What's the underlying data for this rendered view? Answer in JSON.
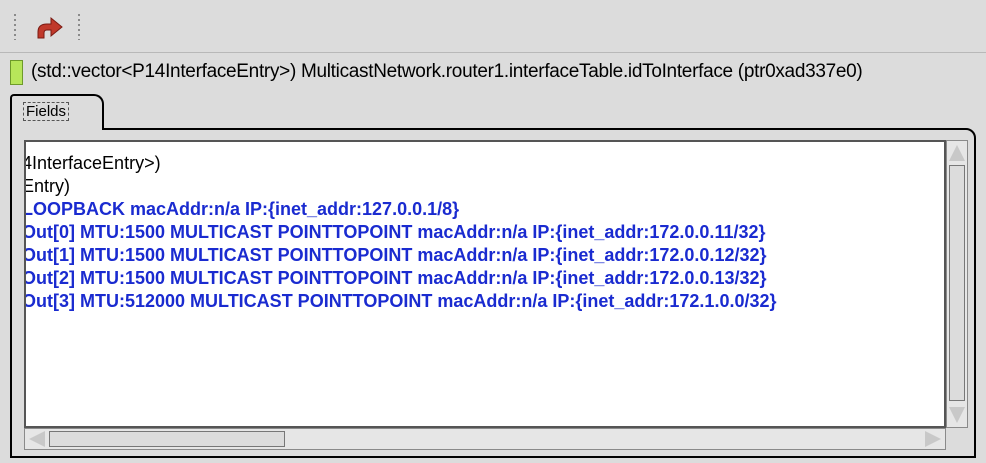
{
  "toolbar": {
    "back_icon": "back-arrow-icon"
  },
  "object_path": {
    "status_color": "#b7e65a",
    "text": "(std::vector<P14InterfaceEntry>) MulticastNetwork.router1.interfaceTable.idToInterface  (ptr0xad337e0)"
  },
  "tabs": [
    {
      "label": "Fields"
    }
  ],
  "fields": {
    "lines": [
      "4InterfaceEntry>)",
      "Entry)",
      "LOOPBACK  macAddr:n/a IP:{inet_addr:127.0.0.1/8}",
      "Out[0]  MTU:1500 MULTICAST POINTTOPOINT  macAddr:n/a IP:{inet_addr:172.0.0.11/32}",
      "Out[1]  MTU:1500 MULTICAST POINTTOPOINT  macAddr:n/a IP:{inet_addr:172.0.0.12/32}",
      "Out[2]  MTU:1500 MULTICAST POINTTOPOINT  macAddr:n/a IP:{inet_addr:172.0.0.13/32}",
      "Out[3]  MTU:512000 MULTICAST POINTTOPOINT  macAddr:n/a IP:{inet_addr:172.1.0.0/32}"
    ]
  },
  "colors": {
    "entry_text": "#1a2bd0",
    "background": "#dcdcdc"
  }
}
